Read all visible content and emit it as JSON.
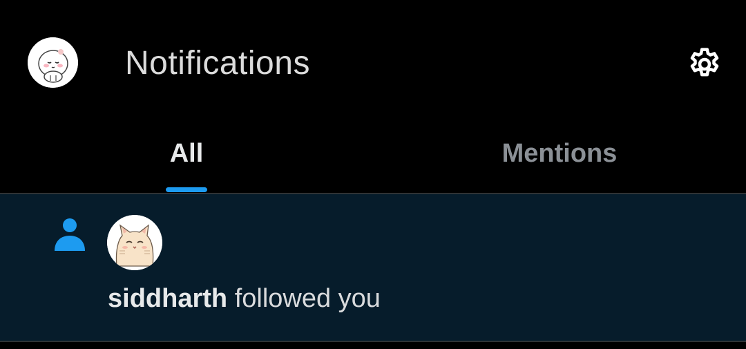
{
  "header": {
    "title": "Notifications",
    "profile_avatar_icon": "mochi-avatar",
    "settings_icon": "gear-icon"
  },
  "tabs": [
    {
      "label": "All",
      "selected": true
    },
    {
      "label": "Mentions",
      "selected": false
    }
  ],
  "notifications": [
    {
      "type_icon": "person-icon",
      "avatar_icon": "cat-avatar",
      "username": "siddharth",
      "action": "followed you"
    }
  ],
  "colors": {
    "accent": "#1d9bf0",
    "background": "#000000",
    "unread_background": "#061c2b",
    "divider": "#2f3336"
  }
}
